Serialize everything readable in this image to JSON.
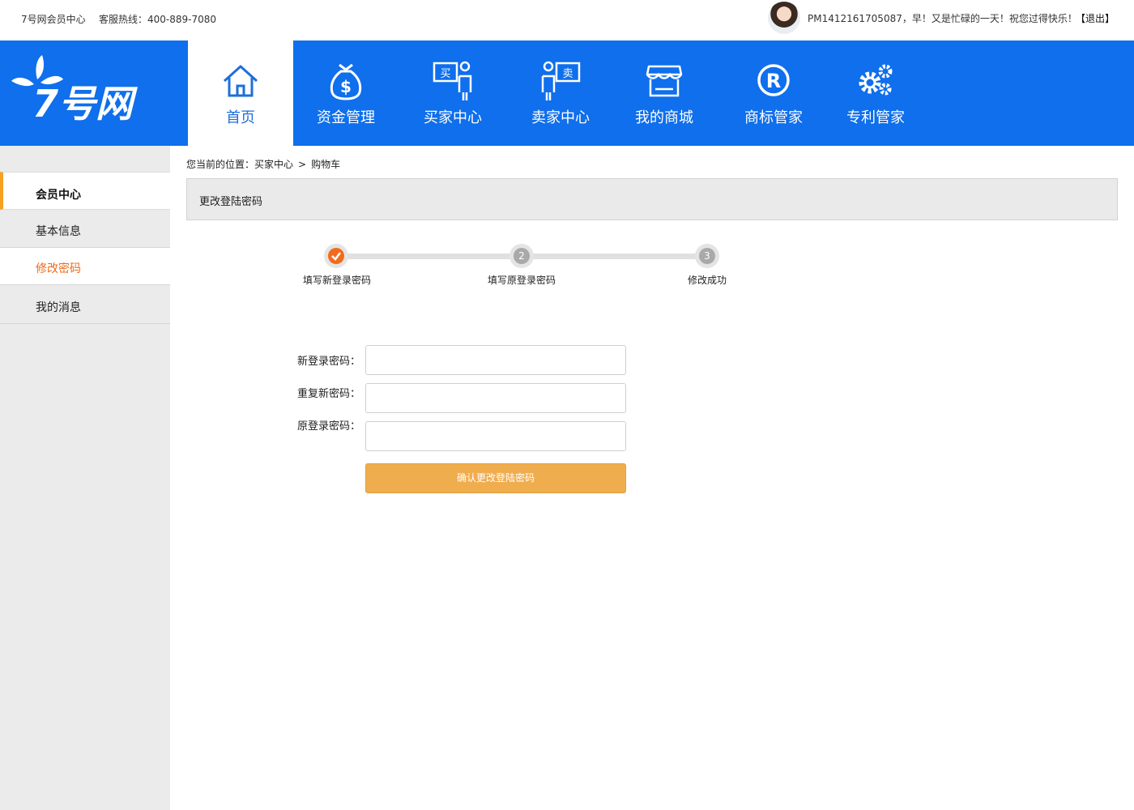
{
  "topbar": {
    "site_name": "7号网会员中心",
    "hotline": "客服热线：400-889-7080",
    "greeting": "PM1412161705087，早！又是忙碌的一天！祝您过得快乐！",
    "logout": "【退出】"
  },
  "logo": {
    "text": "7号网"
  },
  "nav": {
    "items": [
      {
        "label": "首页",
        "icon": "home-icon",
        "active": true
      },
      {
        "label": "资金管理",
        "icon": "money-bag-icon"
      },
      {
        "label": "买家中心",
        "icon": "buyer-icon",
        "icon_text": "买"
      },
      {
        "label": "卖家中心",
        "icon": "seller-icon",
        "icon_text": "卖"
      },
      {
        "label": "我的商城",
        "icon": "store-icon"
      },
      {
        "label": "商标管家",
        "icon": "registered-icon"
      },
      {
        "label": "专利管家",
        "icon": "gears-icon"
      }
    ]
  },
  "sidebar": {
    "header": "会员中心",
    "items": [
      {
        "label": "基本信息"
      },
      {
        "label": "修改密码",
        "current": true
      },
      {
        "label": "我的消息"
      }
    ]
  },
  "breadcrumb": {
    "prefix": "您当前的位置：",
    "level1": "买家中心",
    "separator": ">",
    "level2": "购物车"
  },
  "panel": {
    "title": "更改登陆密码"
  },
  "steps": [
    {
      "number": "1",
      "label": "填写新登录密码",
      "done": true
    },
    {
      "number": "2",
      "label": "填写原登录密码"
    },
    {
      "number": "3",
      "label": "修改成功"
    }
  ],
  "form": {
    "new_password_label": "新登录密码：",
    "new_password_value": "",
    "repeat_password_label": "重复新密码：",
    "repeat_password_value": "",
    "old_password_label": "原登录密码：",
    "old_password_value": "",
    "submit_label": "确认更改登陆密码"
  },
  "colors": {
    "nav_blue": "#0f6fec",
    "accent_orange": "#f26b1d",
    "button_orange": "#f0ad4e",
    "sidebar_gray": "#ebebeb"
  }
}
